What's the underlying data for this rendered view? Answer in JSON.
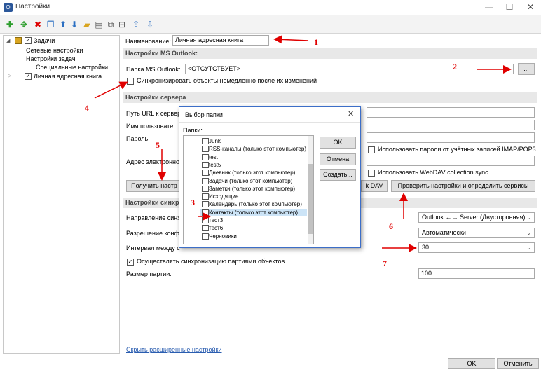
{
  "window": {
    "title": "Настройки",
    "app_icon": "outlook-icon"
  },
  "tree": {
    "items": [
      "Задачи",
      "Сетевые настройки",
      "Настройки задач",
      "Специальные настройки",
      "Личная адресная книга"
    ]
  },
  "main": {
    "name_label": "Наименование:",
    "name_value": "Личная адресная книга",
    "section_outlook": "Настройки MS Outlook:",
    "folder_label": "Папка MS Outlook:",
    "folder_value": "<ОТСУТСТВУЕТ>",
    "browse_label": "...",
    "sync_immediately": "Синхронизировать объекты немедленно после их изменений",
    "section_server": "Настройки сервера",
    "url_label": "Путь URL к сервер",
    "user_label": "Имя пользовате",
    "password_label": "Пароль:",
    "email_label": "Адрес электронно",
    "use_imap_passwords": "Использовать пароли от учётных записей IMAP/POP3",
    "use_webdav": "Использовать WebDAV collection sync",
    "get_settings_btn": "Получить настр",
    "dav_btn": "k DAV",
    "check_settings_btn": "Проверить настройки и определить сервисы",
    "section_sync": "Настройки синхр",
    "sync_direction_label": "Направление синх",
    "sync_direction_value": "Outlook ←→ Server (Двусторонняя)",
    "conflict_label": "Разрешение конф",
    "conflict_value": "Автоматически",
    "interval_label": "Интервал между с",
    "interval_value": "30",
    "chunked_label": "Осуществлять синхронизацию партиями объектов",
    "batch_label": "Размер партии:",
    "batch_value": "100",
    "hide_link": "Скрыть расширенные настройки"
  },
  "dialog": {
    "title": "Выбор папки",
    "folders_label": "Папки:",
    "folders": [
      "Junk",
      "RSS-каналы (только этот компьютер)",
      "test",
      "test5",
      "Дневник (только этот компьютер)",
      "Задачи (только этот компьютер)",
      "Заметки (только этот компьютер)",
      "Исходящие",
      "Календарь (только этот компьютер)",
      "Контакты (только этот компьютер)",
      "тест3",
      "тест6",
      "Черновики"
    ],
    "selected_index": 9,
    "ok": "OK",
    "cancel": "Отмена",
    "create": "Создать..."
  },
  "footer": {
    "ok": "OK",
    "cancel": "Отменить"
  },
  "annotations": [
    "1",
    "2",
    "3",
    "4",
    "5",
    "6",
    "7"
  ],
  "colors": {
    "annotation": "#e00000",
    "selection": "#cce4f7",
    "accent": "#2b579a"
  }
}
